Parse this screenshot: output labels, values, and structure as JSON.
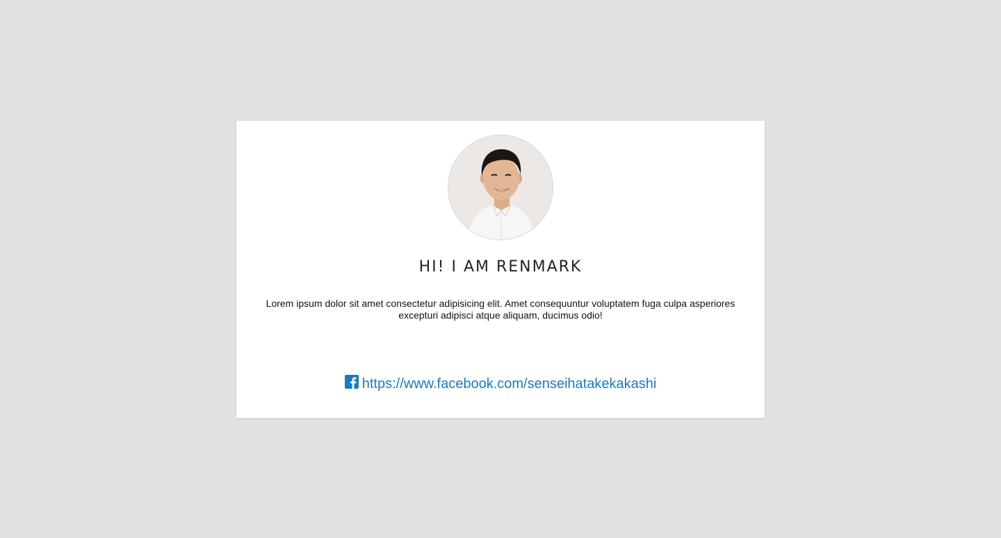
{
  "profile": {
    "heading": "HI! I AM RENMARK",
    "description": "Lorem ipsum dolor sit amet consectetur adipisicing elit. Amet consequuntur voluptatem fuga culpa asperiores excepturi adipisci atque aliquam, ducimus odio!",
    "avatar_icon": "profile-photo"
  },
  "social": {
    "facebook_icon": "facebook-icon",
    "facebook_url": "https://www.facebook.com/senseihatakekakashi"
  },
  "colors": {
    "background": "#e1e1e1",
    "card": "#ffffff",
    "link": "#1a7bbd",
    "facebook_blue": "#1a7bbd"
  }
}
